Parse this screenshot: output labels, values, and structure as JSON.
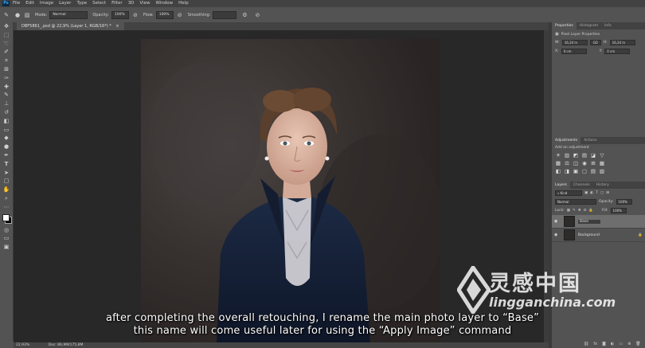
{
  "app": {
    "logo": "Ps"
  },
  "menu": [
    "File",
    "Edit",
    "Image",
    "Layer",
    "Type",
    "Select",
    "Filter",
    "3D",
    "View",
    "Window",
    "Help"
  ],
  "options": {
    "mode_label": "Mode:",
    "mode_value": "Normal",
    "opacity_label": "Opacity:",
    "opacity_value": "100%",
    "flow_label": "Flow:",
    "flow_value": "100%",
    "smoothing_label": "Smoothing:"
  },
  "document_tab": "DBF5861_.psd @ 22,9% (Layer 1, RGB/16*) *",
  "status": {
    "zoom": "22,93%",
    "doc": "Doc: 86,9M/175,8M"
  },
  "properties": {
    "tabs": [
      "Properties",
      "Histogram",
      "Info"
    ],
    "title": "Pixel Layer Properties",
    "w_label": "W:",
    "w_value": "16,24 in",
    "h_label": "H:",
    "h_value": "16,24 in",
    "x_label": "X:",
    "x_value": "0 cm",
    "y_label": "Y:",
    "y_value": "0 cm",
    "link_glyph": "GO"
  },
  "adjustments": {
    "tabs": [
      "Adjustments",
      "Actions"
    ],
    "heading": "Add an adjustment",
    "icons": [
      "☀",
      "▥",
      "◩",
      "▤",
      "◪",
      "▽",
      "▦",
      "⚖",
      "◫",
      "◉",
      "⊞",
      "▩",
      "◧",
      "◨",
      "▣",
      "▢",
      "▤",
      "▧"
    ]
  },
  "layers": {
    "tabs": [
      "Layers",
      "Channels",
      "History"
    ],
    "kind_label": "Kind",
    "blend_mode": "Normal",
    "opacity_label": "Opacity:",
    "opacity_value": "100%",
    "lock_label": "Lock:",
    "fill_label": "Fill:",
    "fill_value": "100%",
    "items": [
      {
        "name": "Base",
        "selected": true
      },
      {
        "name": "Background",
        "selected": false
      }
    ]
  },
  "subtitles": {
    "line1": "after completing the overall retouching, I rename the main photo layer to “Base”",
    "line2": "this name will come useful later for using the “Apply Image” command"
  },
  "watermark": {
    "cn": "灵感中国",
    "url": "lingganchina.com"
  }
}
